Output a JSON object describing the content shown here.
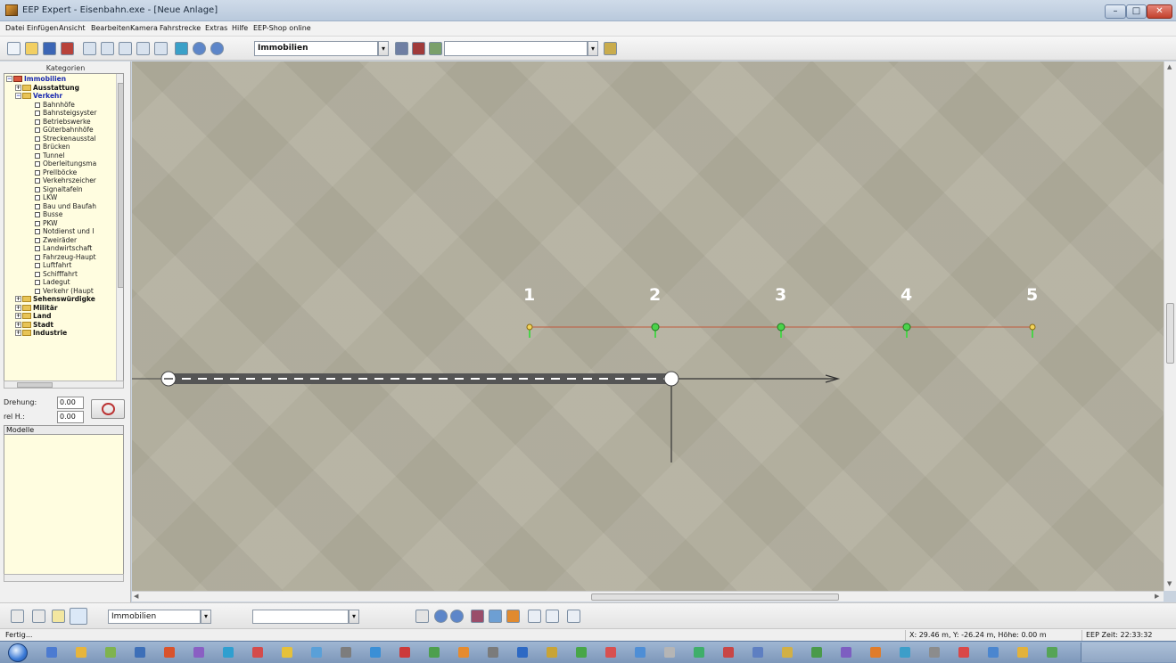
{
  "window": {
    "title": "EEP Expert - Eisenbahn.exe - [Neue Anlage]",
    "buttons": {
      "minimize": "–",
      "maximize": "□",
      "close": "✕"
    }
  },
  "menu": [
    "Datei",
    "Einfügen",
    "Ansicht",
    "Bearbeiten",
    "Kamera",
    "Fahrstrecke",
    "Extras",
    "Hilfe",
    "EEP-Shop online"
  ],
  "toolbar": {
    "category_combo": "Immobilien",
    "search_combo": "",
    "icons": [
      "new-file-icon",
      "open-folder-icon",
      "save-icon",
      "save-as-icon",
      "copy-icon",
      "paste-icon",
      "track-icon",
      "track-edit-icon",
      "track-connect-icon",
      "map-icon",
      "zoom-in-icon",
      "zoom-out-icon",
      "rail-object-icon",
      "signal-icon",
      "road-icon",
      "tools-icon"
    ]
  },
  "left_panel": {
    "header": "Kategorien",
    "tree": [
      {
        "label": "Immobilien",
        "level": 0,
        "kind": "root"
      },
      {
        "label": "Ausstattung",
        "level": 1,
        "kind": "folder"
      },
      {
        "label": "Verkehr",
        "level": 1,
        "kind": "folder-open"
      },
      {
        "label": "Bahnhöfe",
        "level": 2,
        "kind": "leaf"
      },
      {
        "label": "Bahnsteigsyster",
        "level": 2,
        "kind": "leaf"
      },
      {
        "label": "Betriebswerke",
        "level": 2,
        "kind": "leaf"
      },
      {
        "label": "Güterbahnhöfe",
        "level": 2,
        "kind": "leaf"
      },
      {
        "label": "Streckenausstal",
        "level": 2,
        "kind": "leaf"
      },
      {
        "label": "Brücken",
        "level": 2,
        "kind": "leaf"
      },
      {
        "label": "Tunnel",
        "level": 2,
        "kind": "leaf"
      },
      {
        "label": "Oberleitungsma",
        "level": 2,
        "kind": "leaf"
      },
      {
        "label": "Prellböcke",
        "level": 2,
        "kind": "leaf"
      },
      {
        "label": "Verkehrszeicher",
        "level": 2,
        "kind": "leaf"
      },
      {
        "label": "Signaltafeln",
        "level": 2,
        "kind": "leaf"
      },
      {
        "label": "LKW",
        "level": 2,
        "kind": "leaf"
      },
      {
        "label": "Bau und Baufah",
        "level": 2,
        "kind": "leaf"
      },
      {
        "label": "Busse",
        "level": 2,
        "kind": "leaf"
      },
      {
        "label": "PKW",
        "level": 2,
        "kind": "leaf"
      },
      {
        "label": "Notdienst und I",
        "level": 2,
        "kind": "leaf"
      },
      {
        "label": "Zweiräder",
        "level": 2,
        "kind": "leaf"
      },
      {
        "label": "Landwirtschaft",
        "level": 2,
        "kind": "leaf"
      },
      {
        "label": "Fahrzeug-Haupt",
        "level": 2,
        "kind": "leaf"
      },
      {
        "label": "Luftfahrt",
        "level": 2,
        "kind": "leaf"
      },
      {
        "label": "Schifffahrt",
        "level": 2,
        "kind": "leaf"
      },
      {
        "label": "Ladegut",
        "level": 2,
        "kind": "leaf"
      },
      {
        "label": "Verkehr (Haupt",
        "level": 2,
        "kind": "leaf"
      },
      {
        "label": "Sehenswürdigke",
        "level": 1,
        "kind": "folder"
      },
      {
        "label": "Militär",
        "level": 1,
        "kind": "folder"
      },
      {
        "label": "Land",
        "level": 1,
        "kind": "folder"
      },
      {
        "label": "Stadt",
        "level": 1,
        "kind": "folder"
      },
      {
        "label": "Industrie",
        "level": 1,
        "kind": "folder"
      }
    ],
    "drehung_label": "Drehung:",
    "drehung_value": "0.00",
    "rel_h_label": "rel H.:",
    "rel_h_value": "0.00",
    "modelle_header": "Modelle"
  },
  "viewport": {
    "markers": [
      "1",
      "2",
      "3",
      "4",
      "5"
    ]
  },
  "bottom_toolbar": {
    "category_combo": "Immobilien",
    "search_combo": ""
  },
  "status": {
    "left": "Fertig...",
    "coords": "X: 29.46 m, Y: -26.24 m, Höhe: 0.00 m",
    "time": "EEP Zeit: 22:33:32"
  },
  "colors": {
    "viewport_bg": "#b3b09f",
    "marker_line": "#c05a3c",
    "marker_pin": "#4bd24b",
    "track": "#555555"
  }
}
